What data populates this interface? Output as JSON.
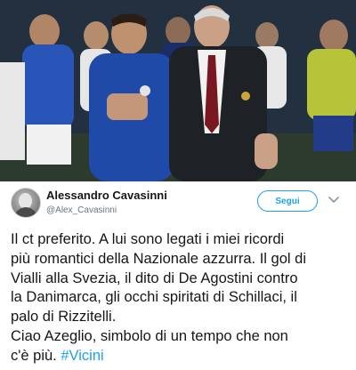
{
  "tweet": {
    "author_name": "Alessandro Cavasinni",
    "author_handle": "@Alex_Cavasinni",
    "follow_label": "Segui",
    "text_lines": [
      "Il ct preferito. A lui sono legati i miei ricordi",
      "più romantici della Nazionale azzurra. Il gol di",
      "Vialli alla Svezia, il dito di De Agostini contro",
      "la Danimarca, gli occhi spiritati di Schillaci, il",
      "palo di Rizzitelli.",
      "Ciao Azeglio, simbolo di un tempo che non",
      "c'è più. "
    ],
    "hashtag": "#Vicini",
    "icons": {
      "avatar": "avatar",
      "more": "chevron-down-icon"
    }
  },
  "colors": {
    "link": "#1da1f2",
    "text": "#14171a",
    "secondary": "#657786",
    "jersey_blue": "#1f4aa8"
  }
}
